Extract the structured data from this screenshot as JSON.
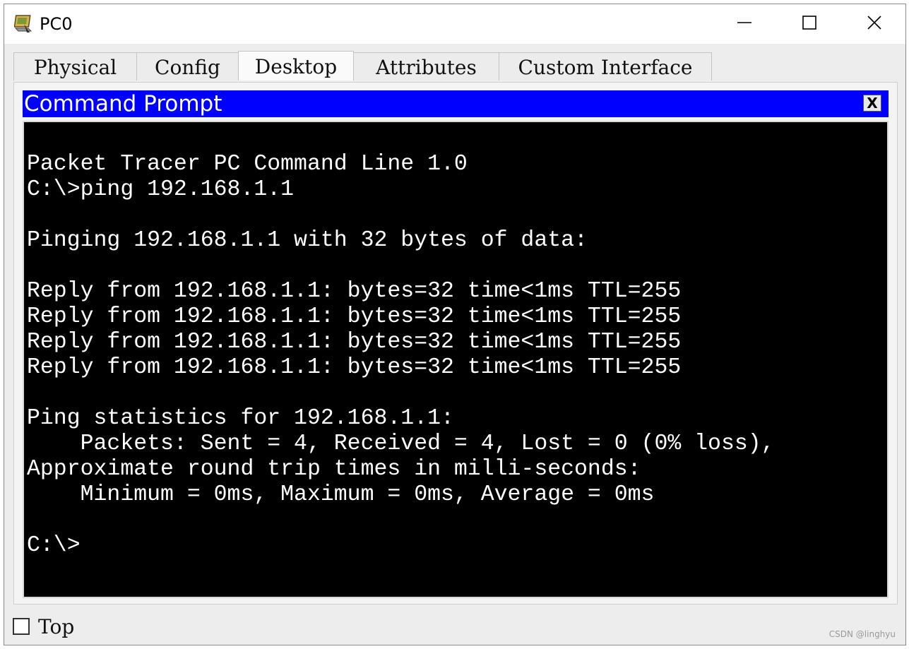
{
  "window": {
    "title": "PC0",
    "icon": "pc-device-icon"
  },
  "window_controls": {
    "minimize_icon": "minimize-icon",
    "maximize_icon": "maximize-icon",
    "close_icon": "close-icon"
  },
  "tabs": [
    {
      "label": "Physical",
      "active": false
    },
    {
      "label": "Config",
      "active": false
    },
    {
      "label": "Desktop",
      "active": true
    },
    {
      "label": "Attributes",
      "active": false
    },
    {
      "label": "Custom Interface",
      "active": false
    }
  ],
  "command_prompt": {
    "title": "Command Prompt",
    "close_label": "X",
    "header_color": "#0000ff",
    "lines": [
      "",
      "Packet Tracer PC Command Line 1.0",
      "C:\\>ping 192.168.1.1",
      "",
      "Pinging 192.168.1.1 with 32 bytes of data:",
      "",
      "Reply from 192.168.1.1: bytes=32 time<1ms TTL=255",
      "Reply from 192.168.1.1: bytes=32 time<1ms TTL=255",
      "Reply from 192.168.1.1: bytes=32 time<1ms TTL=255",
      "Reply from 192.168.1.1: bytes=32 time<1ms TTL=255",
      "",
      "Ping statistics for 192.168.1.1:",
      "    Packets: Sent = 4, Received = 4, Lost = 0 (0% loss),",
      "Approximate round trip times in milli-seconds:",
      "    Minimum = 0ms, Maximum = 0ms, Average = 0ms",
      "",
      "C:\\>"
    ]
  },
  "bottom": {
    "top_checkbox_label": "Top",
    "top_checked": false
  },
  "watermark": "CSDN @linghyu"
}
